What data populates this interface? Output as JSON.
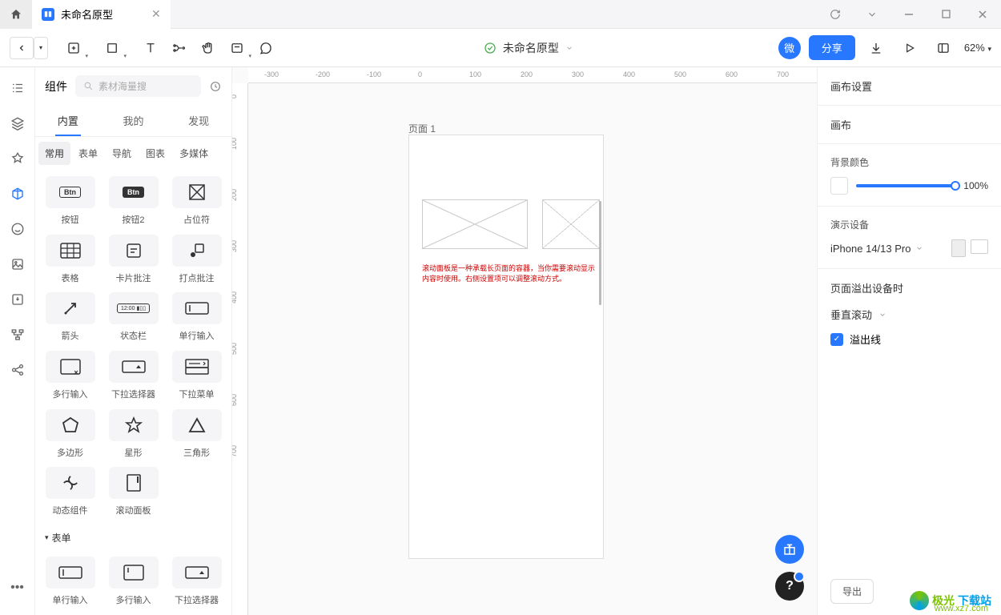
{
  "titlebar": {
    "tab_title": "未命名原型"
  },
  "toolbar": {
    "doc_name": "未命名原型",
    "share_label": "分享",
    "wei_label": "微",
    "zoom": "62%"
  },
  "left_panel": {
    "title": "组件",
    "search_placeholder": "素材海量搜",
    "tabs": [
      "内置",
      "我的",
      "发现"
    ],
    "category_tabs": [
      "常用",
      "表单",
      "导航",
      "图表",
      "多媒体"
    ],
    "components": [
      {
        "label": "按钮",
        "icon": "btn"
      },
      {
        "label": "按钮2",
        "icon": "btn2"
      },
      {
        "label": "占位符",
        "icon": "placeholder"
      },
      {
        "label": "表格",
        "icon": "table"
      },
      {
        "label": "卡片批注",
        "icon": "card"
      },
      {
        "label": "打点批注",
        "icon": "dot"
      },
      {
        "label": "箭头",
        "icon": "arrow"
      },
      {
        "label": "状态栏",
        "icon": "status"
      },
      {
        "label": "单行输入",
        "icon": "input1"
      },
      {
        "label": "多行输入",
        "icon": "textarea"
      },
      {
        "label": "下拉选择器",
        "icon": "select"
      },
      {
        "label": "下拉菜单",
        "icon": "menu"
      },
      {
        "label": "多边形",
        "icon": "polygon"
      },
      {
        "label": "星形",
        "icon": "star"
      },
      {
        "label": "三角形",
        "icon": "triangle"
      },
      {
        "label": "动态组件",
        "icon": "dynamic"
      },
      {
        "label": "滚动面板",
        "icon": "scroll"
      }
    ],
    "section_form": "表单",
    "row4": [
      {
        "label": "单行输入"
      },
      {
        "label": "多行输入"
      },
      {
        "label": "下拉选择器"
      }
    ]
  },
  "canvas": {
    "page_label": "页面 1",
    "helper_text": "滚动面板是一种承载长页面的容器，当你需要滚动显示内容时使用。右侧设置项可以调整滚动方式。",
    "ruler_h": [
      "-300",
      "-200",
      "-100",
      "0",
      "100",
      "200",
      "300",
      "400",
      "500",
      "600",
      "700"
    ],
    "ruler_v": [
      "0",
      "100",
      "200",
      "300",
      "400",
      "500",
      "600",
      "700"
    ]
  },
  "right_panel": {
    "tab1": "画布设置",
    "tab2": "画布",
    "bg_label": "背景颜色",
    "opacity_pct": "100%",
    "device_label": "演示设备",
    "device_value": "iPhone 14/13 Pro",
    "overflow_label": "页面溢出设备时",
    "scroll_value": "垂直滚动",
    "overflow_line_label": "溢出线",
    "export_label": "导出"
  },
  "watermark": {
    "t1": "极光",
    "t2": "下载站",
    "url": "www.xz7.com"
  }
}
